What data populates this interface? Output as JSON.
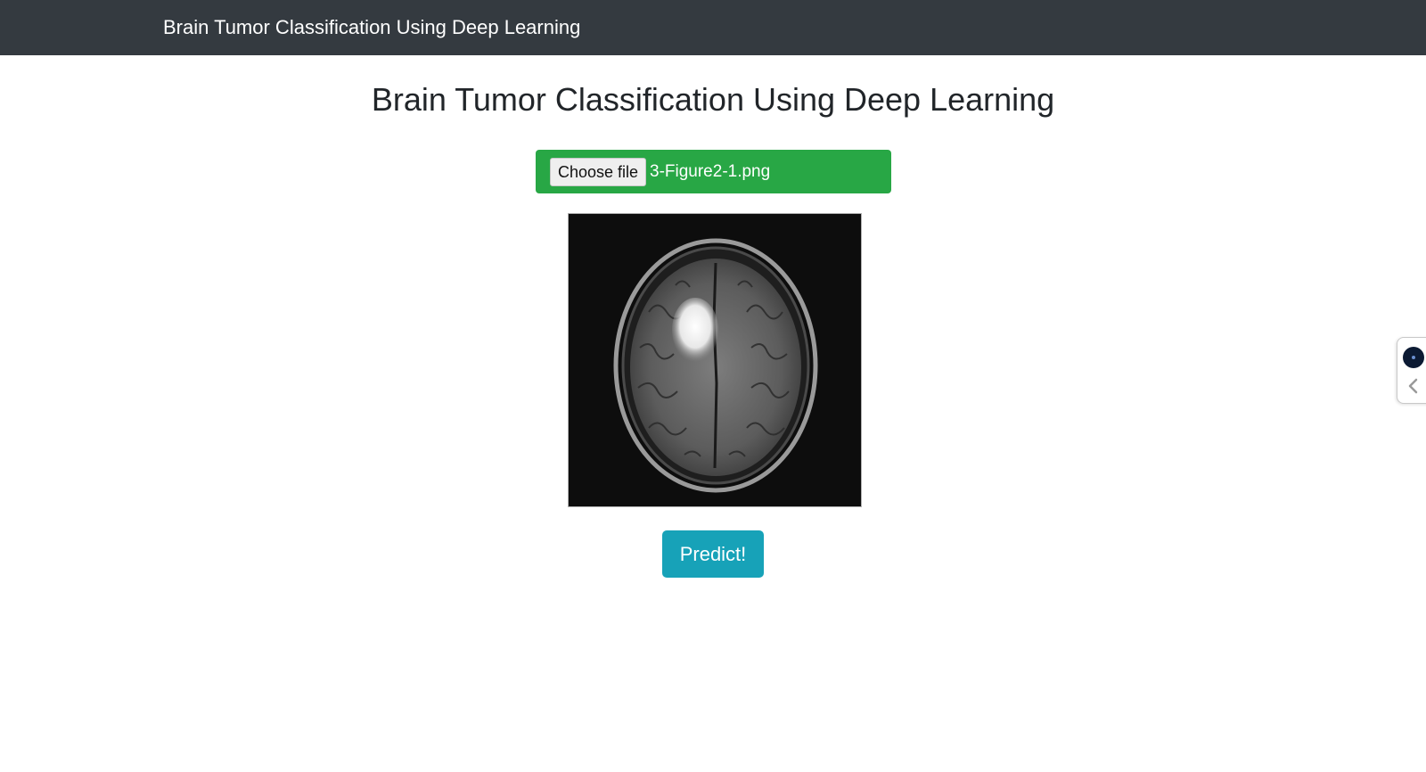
{
  "navbar": {
    "brand": "Brain Tumor Classification Using Deep Learning"
  },
  "main": {
    "title": "Brain Tumor Classification Using Deep Learning",
    "upload": {
      "button_label": "Choose file",
      "file_name": "3-Figure2-1.png"
    },
    "predict_label": "Predict!"
  },
  "side_widget": {
    "logo_icon": "circle-logo-icon",
    "toggle_icon": "chevron-left-icon"
  },
  "colors": {
    "navbar": "#343a40",
    "upload_bar": "#28a745",
    "predict_button": "#17a2b8"
  }
}
